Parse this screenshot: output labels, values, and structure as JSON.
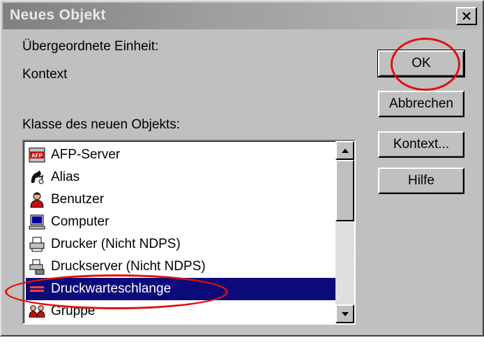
{
  "dialog": {
    "title": "Neues Objekt",
    "parent_label": "Übergeordnete Einheit:",
    "parent_value": "Kontext",
    "class_label": "Klasse des neuen Objekts:"
  },
  "buttons": {
    "ok": "OK",
    "cancel": "Abbrechen",
    "context": "Kontext...",
    "help": "Hilfe"
  },
  "class_list": {
    "selected": "Druckwarteschlange",
    "items": [
      {
        "label": "AFP-Server",
        "icon": "afp-server-icon"
      },
      {
        "label": "Alias",
        "icon": "alias-icon"
      },
      {
        "label": "Benutzer",
        "icon": "user-icon"
      },
      {
        "label": "Computer",
        "icon": "computer-icon"
      },
      {
        "label": "Drucker (Nicht NDPS)",
        "icon": "printer-icon"
      },
      {
        "label": "Druckserver (Nicht NDPS)",
        "icon": "print-server-icon"
      },
      {
        "label": "Druckwarteschlange",
        "icon": "print-queue-icon"
      },
      {
        "label": "Gruppe",
        "icon": "group-icon"
      }
    ]
  },
  "colors": {
    "window": "#c0c0c0",
    "selection": "#0a0a7a",
    "annotation": "#e01010"
  }
}
